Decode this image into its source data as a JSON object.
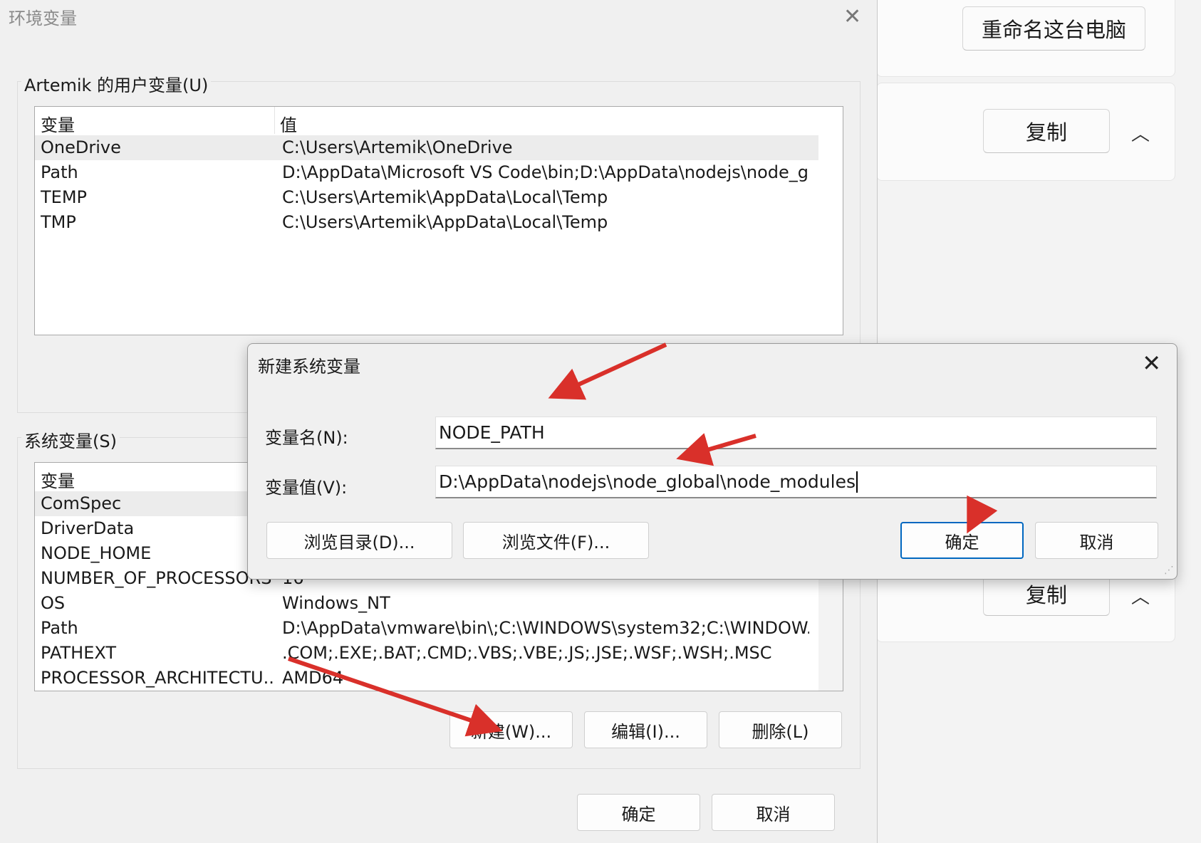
{
  "settings_bg": {
    "rename_button": "重命名这台电脑",
    "copy_button_1": "复制",
    "copy_button_2": "复制"
  },
  "env_dialog": {
    "title": "环境变量",
    "user_group_label": "Artemik 的用户变量(U)",
    "user_list": {
      "header_var": "变量",
      "header_val": "值",
      "rows": [
        {
          "name": "OneDrive",
          "value": "C:\\Users\\Artemik\\OneDrive"
        },
        {
          "name": "Path",
          "value": "D:\\AppData\\Microsoft VS Code\\bin;D:\\AppData\\nodejs\\node_g..."
        },
        {
          "name": "TEMP",
          "value": "C:\\Users\\Artemik\\AppData\\Local\\Temp"
        },
        {
          "name": "TMP",
          "value": "C:\\Users\\Artemik\\AppData\\Local\\Temp"
        }
      ]
    },
    "system_group_label": "系统变量(S)",
    "system_list": {
      "header_var": "变量",
      "rows": [
        {
          "name": "ComSpec",
          "value": ""
        },
        {
          "name": "DriverData",
          "value": ""
        },
        {
          "name": "NODE_HOME",
          "value": ""
        },
        {
          "name": "NUMBER_OF_PROCESSORS",
          "value": "16"
        },
        {
          "name": "OS",
          "value": "Windows_NT"
        },
        {
          "name": "Path",
          "value": "D:\\AppData\\vmware\\bin\\;C:\\WINDOWS\\system32;C:\\WINDOW..."
        },
        {
          "name": "PATHEXT",
          "value": ".COM;.EXE;.BAT;.CMD;.VBS;.VBE;.JS;.JSE;.WSF;.WSH;.MSC"
        },
        {
          "name": "PROCESSOR_ARCHITECTU...",
          "value": "AMD64"
        }
      ]
    },
    "new_button": "新建(W)...",
    "edit_button": "编辑(I)...",
    "delete_button": "删除(L)",
    "ok_button": "确定",
    "cancel_button": "取消"
  },
  "new_var_dialog": {
    "title": "新建系统变量",
    "name_label": "变量名(N):",
    "name_value": "NODE_PATH",
    "value_label": "变量值(V):",
    "value_value": "D:\\AppData\\nodejs\\node_global\\node_modules",
    "browse_dir_button": "浏览目录(D)...",
    "browse_file_button": "浏览文件(F)...",
    "ok_button": "确定",
    "cancel_button": "取消"
  },
  "colors": {
    "annotation_arrow": "#d9302a",
    "primary_border": "#0067c0"
  }
}
